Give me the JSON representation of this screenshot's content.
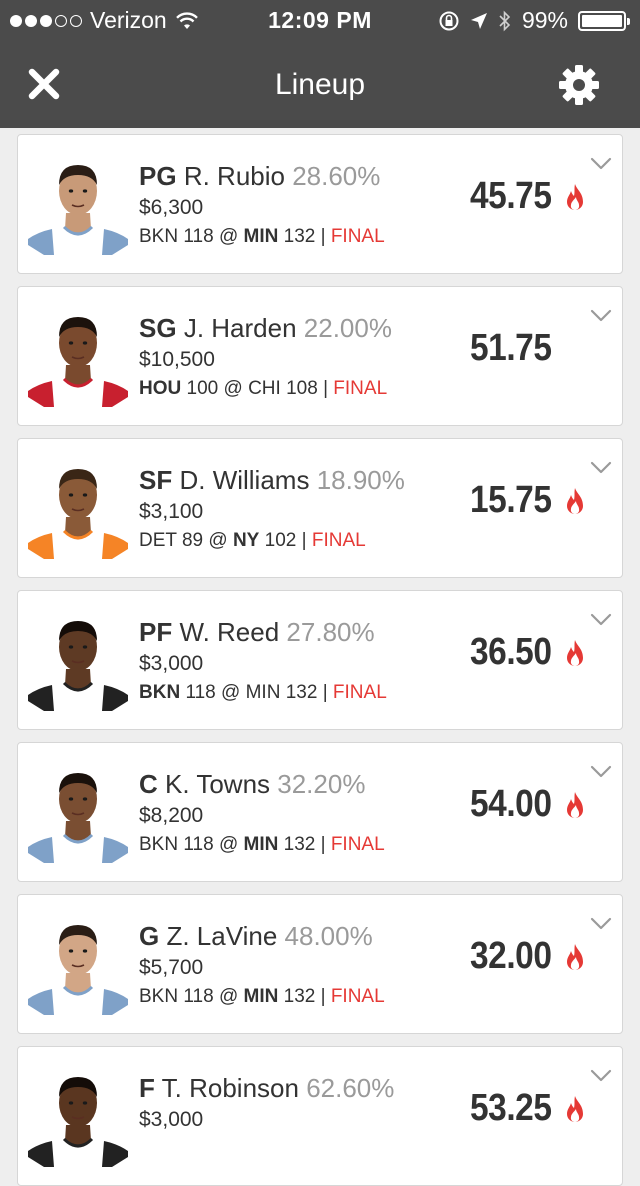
{
  "status_bar": {
    "carrier": "Verizon",
    "time": "12:09 PM",
    "battery": "99%",
    "signal_bars_filled": 3,
    "signal_bars_total": 5
  },
  "nav": {
    "title": "Lineup",
    "close_icon": "close-icon",
    "settings_icon": "gear-icon"
  },
  "colors": {
    "header_bg": "#4b4b4b",
    "final": "#e53935",
    "ownership": "#9a9a9a",
    "fire": "#e53935"
  },
  "players": [
    {
      "pos": "PG",
      "name": "R. Rubio",
      "own": "28.60%",
      "salary": "$6,300",
      "away_team": "BKN",
      "away_score": "118",
      "at": "@",
      "home_team": "MIN",
      "home_score": "132",
      "bold_side": "home",
      "sep": "|",
      "status": "FINAL",
      "points": "45.75",
      "hot": true,
      "skin": "#c89a78",
      "hair": "#2a1d15",
      "jersey": "#ffffff",
      "trim": "#7fa1c8"
    },
    {
      "pos": "SG",
      "name": "J. Harden",
      "own": "22.00%",
      "salary": "$10,500",
      "away_team": "HOU",
      "away_score": "100",
      "at": "@",
      "home_team": "CHI",
      "home_score": "108",
      "bold_side": "away",
      "sep": "|",
      "status": "FINAL",
      "points": "51.75",
      "hot": false,
      "skin": "#7a4a2e",
      "hair": "#1c120c",
      "jersey": "#ffffff",
      "trim": "#c8202f"
    },
    {
      "pos": "SF",
      "name": "D. Williams",
      "own": "18.90%",
      "salary": "$3,100",
      "away_team": "DET",
      "away_score": "89",
      "at": "@",
      "home_team": "NY",
      "home_score": "102",
      "bold_side": "home",
      "sep": "|",
      "status": "FINAL",
      "points": "15.75",
      "hot": true,
      "skin": "#8a5a38",
      "hair": "#3a2616",
      "jersey": "#ffffff",
      "trim": "#f58426"
    },
    {
      "pos": "PF",
      "name": "W. Reed",
      "own": "27.80%",
      "salary": "$3,000",
      "away_team": "BKN",
      "away_score": "118",
      "at": "@",
      "home_team": "MIN",
      "home_score": "132",
      "bold_side": "away",
      "sep": "|",
      "status": "FINAL",
      "points": "36.50",
      "hot": true,
      "skin": "#5e3a24",
      "hair": "#140c08",
      "jersey": "#ffffff",
      "trim": "#222222"
    },
    {
      "pos": "C",
      "name": "K. Towns",
      "own": "32.20%",
      "salary": "$8,200",
      "away_team": "BKN",
      "away_score": "118",
      "at": "@",
      "home_team": "MIN",
      "home_score": "132",
      "bold_side": "home",
      "sep": "|",
      "status": "FINAL",
      "points": "54.00",
      "hot": true,
      "skin": "#7a4e32",
      "hair": "#1a110b",
      "jersey": "#ffffff",
      "trim": "#7fa1c8"
    },
    {
      "pos": "G",
      "name": "Z. LaVine",
      "own": "48.00%",
      "salary": "$5,700",
      "away_team": "BKN",
      "away_score": "118",
      "at": "@",
      "home_team": "MIN",
      "home_score": "132",
      "bold_side": "home",
      "sep": "|",
      "status": "FINAL",
      "points": "32.00",
      "hot": true,
      "skin": "#d2a686",
      "hair": "#2a1d15",
      "jersey": "#ffffff",
      "trim": "#7fa1c8"
    },
    {
      "pos": "F",
      "name": "T. Robinson",
      "own": "62.60%",
      "salary": "$3,000",
      "away_team": "",
      "away_score": "",
      "at": "",
      "home_team": "",
      "home_score": "",
      "bold_side": "none",
      "sep": "",
      "status": "",
      "points": "53.25",
      "hot": true,
      "skin": "#5a3620",
      "hair": "#140c08",
      "jersey": "#ffffff",
      "trim": "#222222"
    }
  ]
}
